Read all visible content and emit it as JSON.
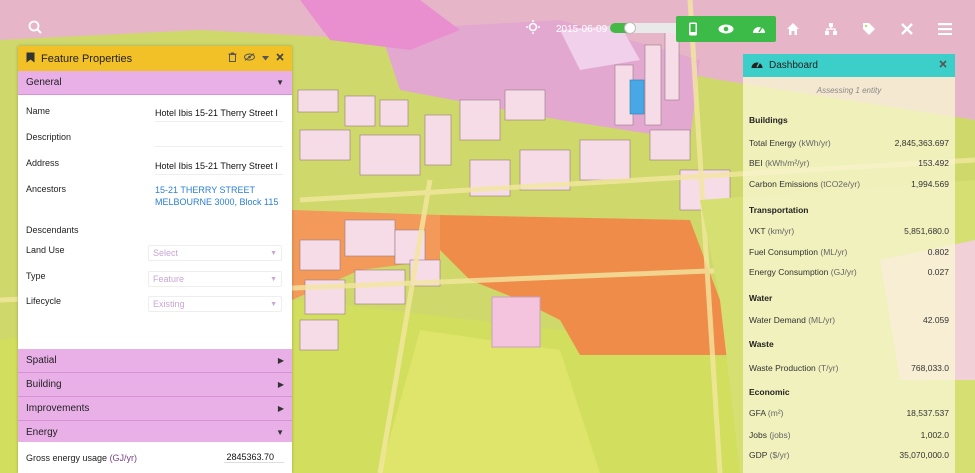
{
  "colors": {
    "feature_header": "#f2c027",
    "section": "#e9b0e8",
    "dashboard_header": "#3ccfc9",
    "toolbar_green": "#3dbb48",
    "link": "#2a7fd4"
  },
  "toolbar": {
    "date": "2015-06-09",
    "icons": [
      "search-icon",
      "sun-icon",
      "phone-icon",
      "eye-icon",
      "dashboard-icon",
      "home-icon",
      "network-icon",
      "tag-icon",
      "close-icon",
      "menu-icon"
    ]
  },
  "feature_panel": {
    "title": "Feature Properties",
    "general_label": "General",
    "fields": {
      "name_label": "Name",
      "name_value": "Hotel Ibis 15-21 Therry Street I",
      "description_label": "Description",
      "address_label": "Address",
      "address_value": "Hotel Ibis 15-21 Therry Street I",
      "ancestors_label": "Ancestors",
      "ancestors_value": "15-21 THERRY STREET MELBOURNE 3000, Block 115",
      "descendants_label": "Descendants",
      "land_use_label": "Land Use",
      "land_use_value": "Select",
      "type_label": "Type",
      "type_value": "Feature",
      "lifecycle_label": "Lifecycle",
      "lifecycle_value": "Existing"
    },
    "sections": [
      "Spatial",
      "Building",
      "Improvements",
      "Energy"
    ],
    "energy": {
      "label": "Gross energy usage",
      "unit": "(GJ/yr)",
      "value": "2845363.70"
    }
  },
  "dashboard": {
    "title": "Dashboard",
    "subtitle": "Assessing 1 entity",
    "buildings": {
      "heading": "Buildings",
      "total_energy_label": "Total Energy",
      "total_energy_unit": "(kWh/yr)",
      "total_energy_value": "2,845,363.697",
      "bei_label": "BEI",
      "bei_unit": "(kWh/m²/yr)",
      "bei_value": "153.492",
      "carbon_label": "Carbon Emissions",
      "carbon_unit": "(tCO2e/yr)",
      "carbon_value": "1,994.569"
    },
    "transportation": {
      "heading": "Transportation",
      "vkt_label": "VKT",
      "vkt_unit": "(km/yr)",
      "vkt_value": "5,851,680.0",
      "fuel_label": "Fuel Consumption",
      "fuel_unit": "(ML/yr)",
      "fuel_value": "0.802",
      "energy_label": "Energy Consumption",
      "energy_unit": "(GJ/yr)",
      "energy_value": "0.027"
    },
    "water": {
      "heading": "Water",
      "demand_label": "Water Demand",
      "demand_unit": "(ML/yr)",
      "demand_value": "42.059"
    },
    "waste": {
      "heading": "Waste",
      "production_label": "Waste Production",
      "production_unit": "(T/yr)",
      "production_value": "768,033.0"
    },
    "economic": {
      "heading": "Economic",
      "gfa_label": "GFA",
      "gfa_unit": "(m²)",
      "gfa_value": "18,537.537",
      "jobs_label": "Jobs",
      "jobs_unit": "(jobs)",
      "jobs_value": "1,002.0",
      "gdp_label": "GDP",
      "gdp_unit": "($/yr)",
      "gdp_value": "35,070,000.0"
    }
  }
}
